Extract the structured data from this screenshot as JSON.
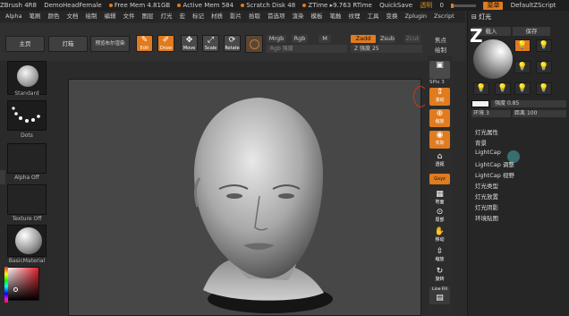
{
  "titlebar": {
    "app": "ZBrush 4R8",
    "doc": "DemoHeadFemale",
    "free_mem": "Free Mem 4.81GB",
    "active_mem": "Active Mem 584",
    "scratch": "Scratch Disk 48",
    "ztime": "ZTime",
    "rtime": "9.763 RTime",
    "quicksave": "QuickSave",
    "transp_label": "透明",
    "transp_value": "0",
    "menu_button": "菜单",
    "zscript": "DefaultZScript"
  },
  "menubar": [
    "Alpha",
    "笔刷",
    "颜色",
    "文档",
    "绘制",
    "编辑",
    "文件",
    "图层",
    "灯光",
    "宏",
    "标记",
    "材质",
    "影片",
    "拾取",
    "首选项",
    "渲染",
    "模板",
    "笔触",
    "纹理",
    "工具",
    "变换",
    "Zplugin",
    "Zscript"
  ],
  "toolbar": {
    "home": "主页",
    "lightbox": "灯箱",
    "bool": "预览布尔渲染",
    "edit": "Edit",
    "draw": "Draw",
    "move": "Move",
    "scale": "Scale",
    "rotate": "Rotate",
    "mrgb": "Mrgb",
    "rgb": "Rgb",
    "m": "M",
    "rgb_intensity": "Rgb 强度",
    "zadd": "Zadd",
    "zsub": "Zsub",
    "zcut": "Zcut",
    "z_intensity_label": "Z 强度",
    "z_intensity_value": "25",
    "focal_label": "焦点",
    "draw_size_label": "绘制"
  },
  "leftshelf": {
    "brush": "Standard",
    "stroke": "Dots",
    "alpha": "Alpha Off",
    "texture": "Texture Off",
    "material": "BasicMaterial"
  },
  "righttools": {
    "spix_label": "SPix",
    "spix_value": "3",
    "scroll": "滚动",
    "zoom": "缩放",
    "actual": "实际",
    "persp": "透视",
    "floor": "地面",
    "local": "局部",
    "xyz": "Gxyz",
    "frame": "框选",
    "move": "移动",
    "zoom3d": "缩放",
    "rotate": "旋转",
    "linefill": "Line Fill",
    "polyf": "PolyF"
  },
  "rightpanel": {
    "title": "灯光",
    "load": "载入",
    "save": "保存",
    "intensity_label": "强度",
    "intensity_value": "0.85",
    "ambient_label": "环境",
    "ambient_value": "3",
    "distance_label": "距离",
    "distance_value": "100",
    "items": [
      "灯光属性",
      "背景",
      "LightCap",
      "LightCap 调整",
      "LightCap 视野",
      "灯光类型",
      "灯光放置",
      "灯光阴影",
      "环境贴图"
    ]
  },
  "colors": {
    "accent": "#e07b1e",
    "panel": "#262626",
    "canvas": "#474747"
  }
}
